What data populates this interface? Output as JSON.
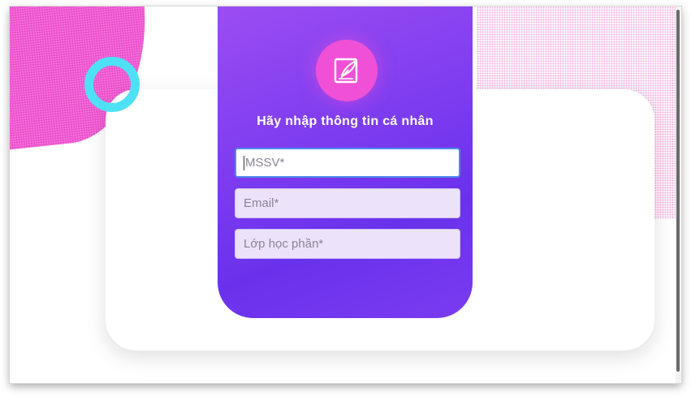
{
  "colors": {
    "accent_pink": "#ee53cf",
    "panel_purple": "#7f3df0",
    "ring_cyan": "#4ee1f5",
    "focus_blue": "#4e89e8"
  },
  "header": {
    "icon": "edit-note-icon",
    "title": "Hãy nhập thông tin cá nhân"
  },
  "form": {
    "mssv": {
      "placeholder": "MSSV*",
      "value": ""
    },
    "email": {
      "placeholder": "Email*",
      "value": ""
    },
    "class_section": {
      "placeholder": "Lớp học phần*",
      "value": ""
    }
  }
}
